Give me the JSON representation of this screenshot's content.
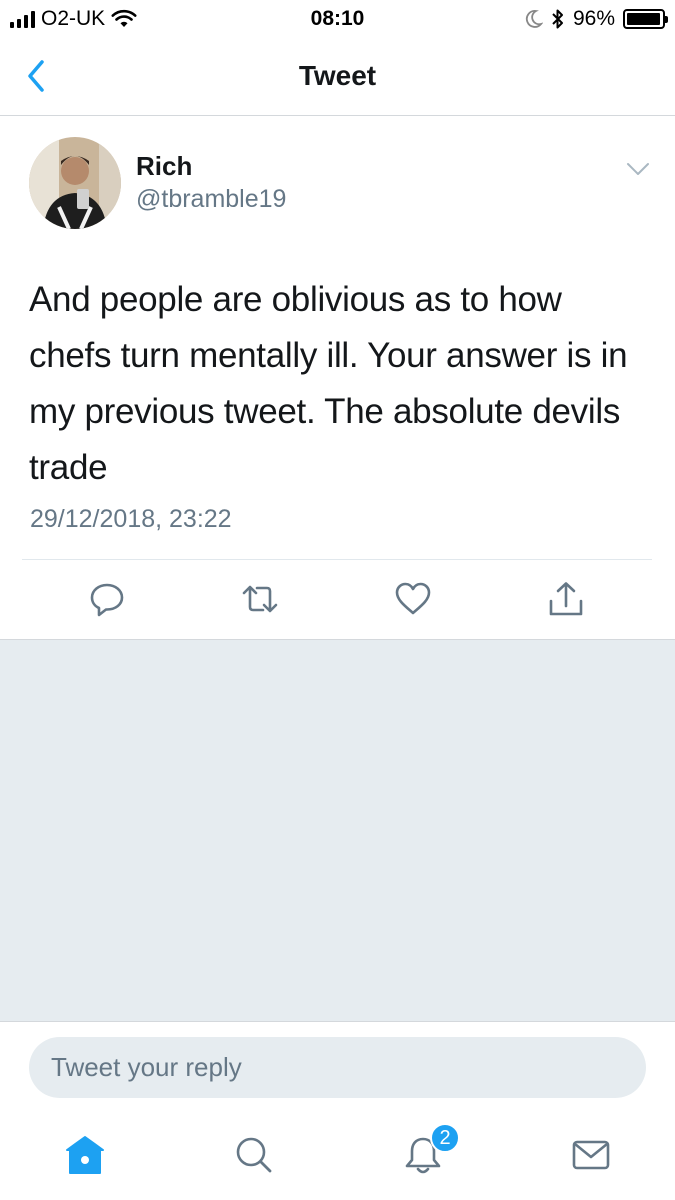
{
  "status_bar": {
    "carrier": "O2-UK",
    "time": "08:10",
    "battery_percent": "96%",
    "battery_level": 0.96,
    "icons": [
      "signal-icon",
      "wifi-icon",
      "moon-icon",
      "bluetooth-icon",
      "battery-icon"
    ]
  },
  "nav": {
    "title": "Tweet",
    "back_icon": "chevron-left-icon"
  },
  "tweet": {
    "author_name": "Rich",
    "author_handle": "@tbramble19",
    "text": "And people are oblivious as to how chefs turn mentally ill. Your answer is in my previous tweet. The absolute devils trade",
    "timestamp": "29/12/2018, 23:22",
    "actions": [
      "reply-icon",
      "retweet-icon",
      "like-icon",
      "share-icon"
    ]
  },
  "reply": {
    "placeholder": "Tweet your reply"
  },
  "tabbar": {
    "tabs": [
      "home-icon",
      "search-icon",
      "notifications-icon",
      "messages-icon"
    ],
    "notifications_badge": "2"
  },
  "colors": {
    "accent": "#1da1f2",
    "text_primary": "#14171a",
    "text_secondary": "#657786",
    "background_grey": "#e6ecf0"
  }
}
